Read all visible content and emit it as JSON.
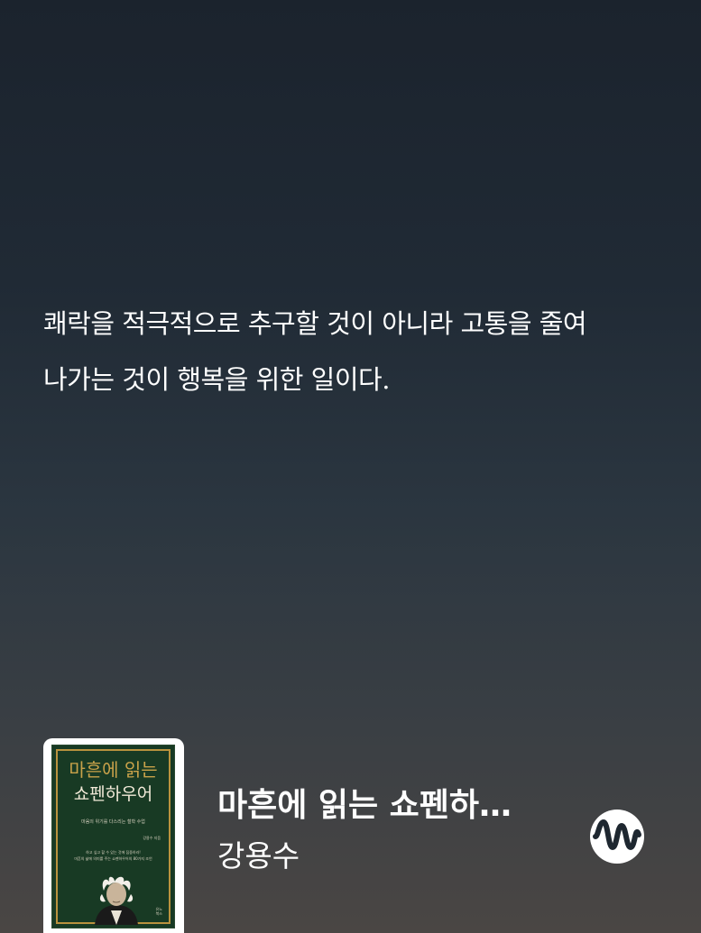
{
  "quote": {
    "line1": "쾌락을 적극적으로 추구할 것이 아니라 고통을 줄여",
    "line2": "나가는 것이 행복을 위한 일이다."
  },
  "book": {
    "title": "마흔에 읽는 쇼펜하…",
    "author": "강용수",
    "cover": {
      "title_line1": "마흔에 읽는",
      "title_line2": "쇼펜하우어",
      "subtitle": "마음의 위기를 다스리는 철학 수업",
      "author": "강용수 지음",
      "blurb_line1": "하고 싶고 할 수 있는 것에 집중하라!",
      "blurb_line2": "마흔의 삶에 의미를 주는 쇼펜하우어의 80가지 조언",
      "publisher_line1": "유노",
      "publisher_line2": "북스"
    }
  },
  "icons": {
    "brand": "brand-wave-logo-icon",
    "portrait": "philosopher-portrait-icon"
  },
  "colors": {
    "background_top": "#1b232d",
    "background_bottom": "#4a4644",
    "cover_green": "#183a24",
    "cover_gold": "#c9a24a",
    "text": "#ffffff"
  }
}
